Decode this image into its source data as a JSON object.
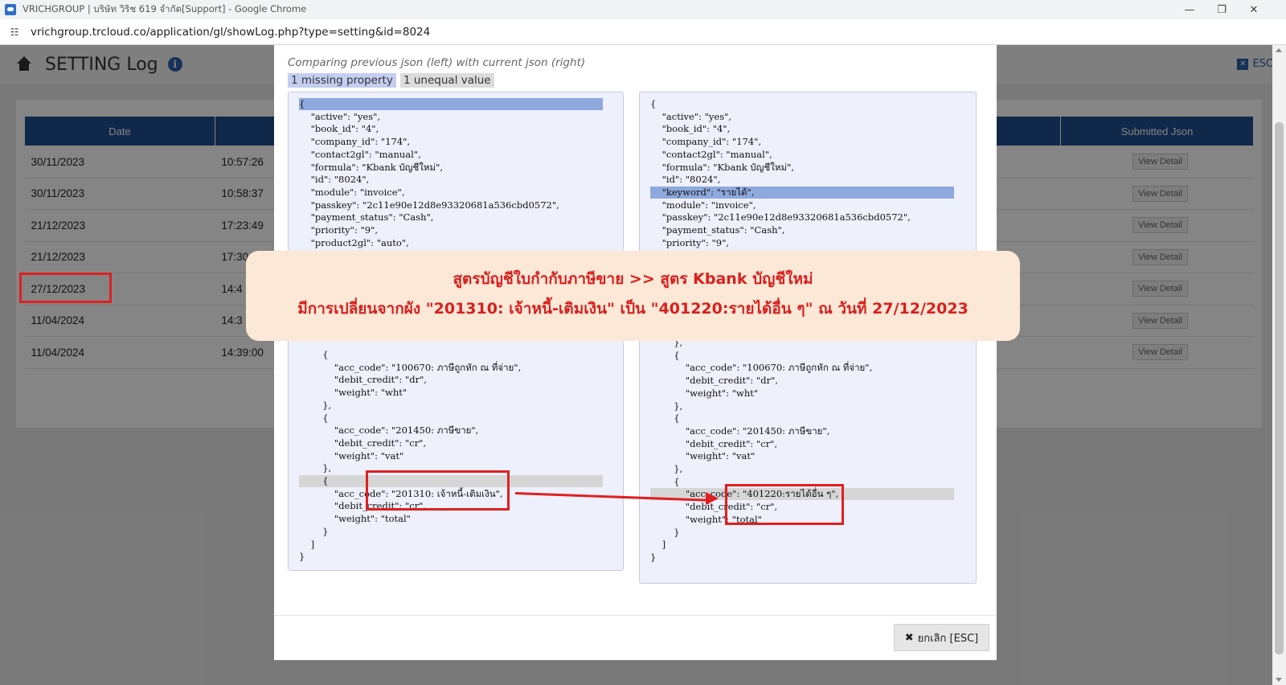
{
  "browser": {
    "window_title": "VRICHGROUP | บริษัท วิริช 619 จำกัด[Support] - Google Chrome",
    "url": "vrichgroup.trcloud.co/application/gl/showLog.php?type=setting&id=8024"
  },
  "page": {
    "title": "SETTING Log",
    "esc_label": "ESC",
    "table": {
      "headers": [
        "Date",
        "",
        "Submitted Json"
      ],
      "view_label": "View Detail",
      "rows": [
        {
          "date": "30/11/2023",
          "time": "10:57:26"
        },
        {
          "date": "30/11/2023",
          "time": "10:58:37"
        },
        {
          "date": "21/12/2023",
          "time": "17:23:49"
        },
        {
          "date": "21/12/2023",
          "time": "17:30"
        },
        {
          "date": "27/12/2023",
          "time": "14:4"
        },
        {
          "date": "11/04/2024",
          "time": "14:3"
        },
        {
          "date": "11/04/2024",
          "time": "14:39:00"
        }
      ]
    }
  },
  "modal": {
    "compare_note": "Comparing previous json (left) with current json (right)",
    "missing_badge": "1 missing property",
    "unequal_badge": "1 unequal value",
    "left_json": [
      "{",
      "    \"active\": \"yes\",",
      "    \"book_id\": \"4\",",
      "    \"company_id\": \"174\",",
      "    \"contact2gl\": \"manual\",",
      "    \"formula\": \"Kbank บัญชีใหม่\",",
      "    \"id\": \"8024\",",
      "    \"module\": \"invoice\",",
      "    \"passkey\": \"2c11e90e12d8e93320681a536cbd0572\",",
      "    \"payment_status\": \"Cash\",",
      "    \"priority\": \"9\",",
      "    \"product2gl\": \"auto\","
    ],
    "left_json_bottom": [
      "        {",
      "            \"acc_code\": \"100670: ภาษีถูกหัก ณ ที่จ่าย\",",
      "            \"debit_credit\": \"dr\",",
      "            \"weight\": \"wht\"",
      "        },",
      "        {",
      "            \"acc_code\": \"201450: ภาษีขาย\",",
      "            \"debit_credit\": \"cr\",",
      "            \"weight\": \"vat\"",
      "        },",
      "        {",
      "            \"acc_code\": \"201310: เจ้าหนี้-เติมเงิน\",",
      "            \"debit_credit\": \"cr\",",
      "            \"weight\": \"total\"",
      "        }",
      "    ]",
      "}"
    ],
    "right_json": [
      "{",
      "    \"active\": \"yes\",",
      "    \"book_id\": \"4\",",
      "    \"company_id\": \"174\",",
      "    \"contact2gl\": \"manual\",",
      "    \"formula\": \"Kbank บัญชีใหม่\",",
      "    \"id\": \"8024\",",
      "    \"keyword\": \"รายได้\",",
      "    \"module\": \"invoice\",",
      "    \"passkey\": \"2c11e90e12d8e93320681a536cbd0572\",",
      "    \"payment_status\": \"Cash\",",
      "    \"priority\": \"9\","
    ],
    "right_json_bottom": [
      "        },",
      "        {",
      "            \"acc_code\": \"100670: ภาษีถูกหัก ณ ที่จ่าย\",",
      "            \"debit_credit\": \"dr\",",
      "            \"weight\": \"wht\"",
      "        },",
      "        {",
      "            \"acc_code\": \"201450: ภาษีขาย\",",
      "            \"debit_credit\": \"cr\",",
      "            \"weight\": \"vat\"",
      "        },",
      "        {",
      "            \"acc_code\": \"401220:รายได้อื่น ๆ\",",
      "            \"debit_credit\": \"cr\",",
      "            \"weight\": \"total\"",
      "        }",
      "    ]",
      "}"
    ],
    "cancel_label": "ยกเลิก [ESC]"
  },
  "annotation": {
    "line1": "สูตรบัญชีใบกำกับภาษีขาย >> สูตร Kbank บัญชีใหม่",
    "line2": "มีการเปลี่ยนจากผัง \"201310: เจ้าหนี้-เติมเงิน\" เป็น \"401220:รายได้อื่น ๆ\" ณ วันที่ 27/12/2023"
  },
  "colors": {
    "header_blue": "#1f4e8c",
    "missing_highlight": "#8ea9dd",
    "unequal_highlight": "#d6d6d6",
    "annotation_red": "#d81f1f",
    "callout_bg": "#fbe8d6"
  }
}
